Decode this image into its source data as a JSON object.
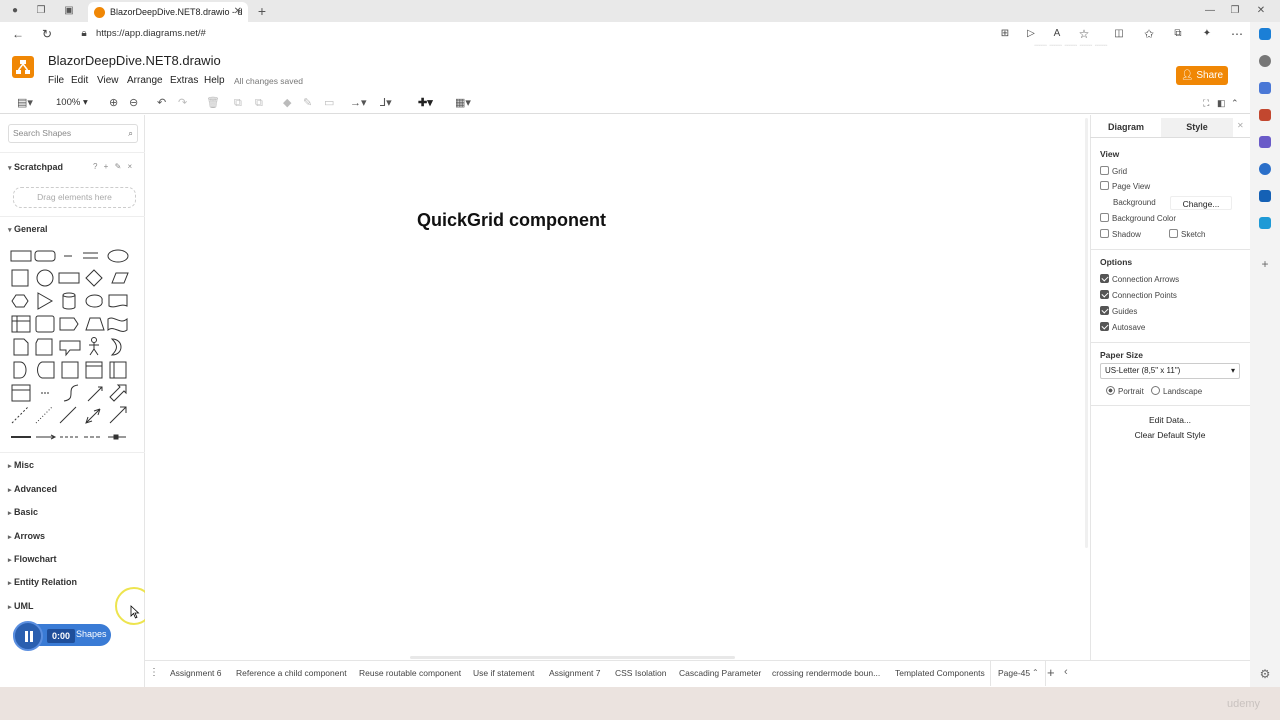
{
  "browser": {
    "tab_title": "BlazorDeepDive.NET8.drawio - d",
    "url": "https://app.diagrams.net/#"
  },
  "app": {
    "doc_title": "BlazorDeepDive.NET8.drawio",
    "menu": [
      "File",
      "Edit",
      "View",
      "Arrange",
      "Extras",
      "Help"
    ],
    "save_status": "All changes saved",
    "share_label": "Share",
    "zoom": "100%"
  },
  "left_panel": {
    "search_placeholder": "Search Shapes",
    "scratchpad_title": "Scratchpad",
    "scratchpad_tools": "? + ✎ ×",
    "drag_hint": "Drag elements here",
    "sections": [
      "General",
      "Misc",
      "Advanced",
      "Basic",
      "Arrows",
      "Flowchart",
      "Entity Relation",
      "UML"
    ],
    "more_shapes": "Shapes"
  },
  "canvas": {
    "title": "QuickGrid component"
  },
  "right_panel": {
    "tabs": [
      "Diagram",
      "Style"
    ],
    "view_heading": "View",
    "grid_label": "Grid",
    "page_view_label": "Page View",
    "background_label": "Background",
    "change_label": "Change...",
    "bg_color_label": "Background Color",
    "shadow_label": "Shadow",
    "sketch_label": "Sketch",
    "options_heading": "Options",
    "options": [
      "Connection Arrows",
      "Connection Points",
      "Guides",
      "Autosave"
    ],
    "paper_heading": "Paper Size",
    "paper_value": "US-Letter (8,5\" x 11\")",
    "portrait_label": "Portrait",
    "landscape_label": "Landscape",
    "edit_data": "Edit Data...",
    "clear_style": "Clear Default Style"
  },
  "page_tabs": [
    "Assignment 6",
    "Reference a child component",
    "Reuse routable component",
    "Use if statement",
    "Assignment 7",
    "CSS Isolation",
    "Cascading Parameter",
    "crossing rendermode boun...",
    "Templated Components",
    "Page-45"
  ],
  "recorder": {
    "time": "0:00"
  },
  "footer": {
    "brand": "udemy"
  }
}
